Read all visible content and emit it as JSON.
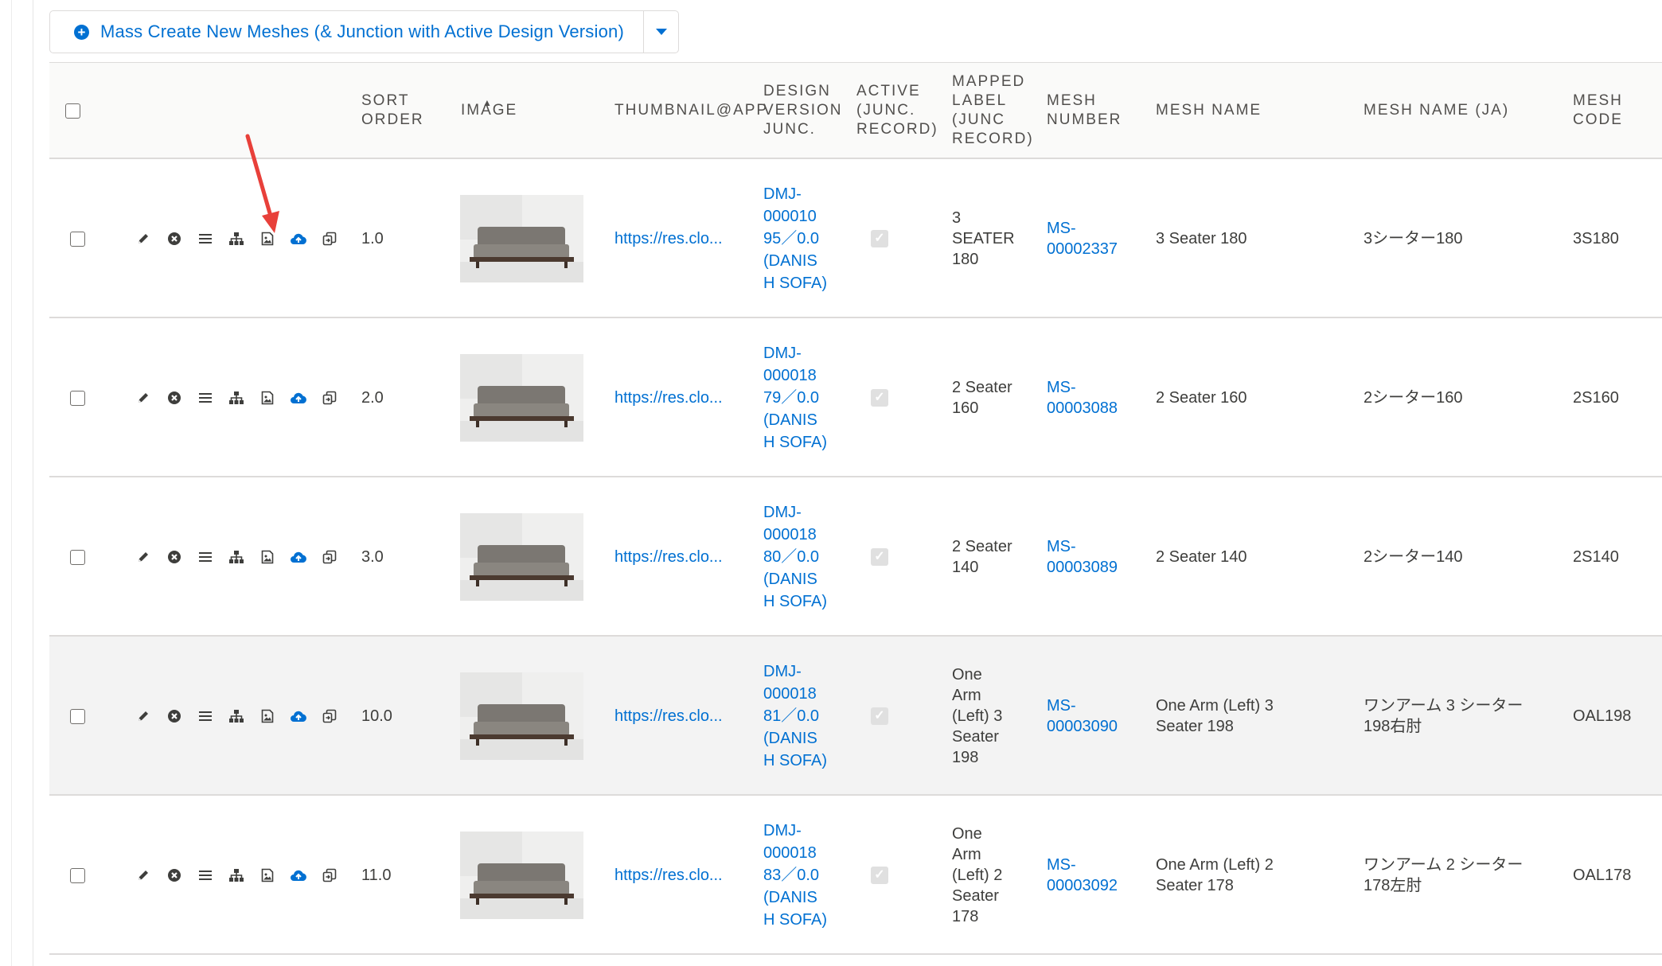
{
  "toolbar": {
    "mass_create_label": "Mass Create New Meshes (& Junction with Active Design Version)"
  },
  "columns": {
    "sort_order": [
      "SORT",
      "ORDER"
    ],
    "image": "IMAGE",
    "thumbnail": "THUMBNAIL@APP",
    "design_version": [
      "DESIGN",
      "VERSION",
      "JUNC."
    ],
    "active": [
      "ACTIVE",
      "(JUNC.",
      "RECORD)"
    ],
    "mapped_label": [
      "MAPPED",
      "LABEL",
      "(JUNC",
      "RECORD)"
    ],
    "mesh_number": [
      "MESH",
      "NUMBER"
    ],
    "mesh_name": "MESH NAME",
    "mesh_name_ja": "MESH NAME (JA)",
    "mesh_code": [
      "MESH",
      "CODE"
    ]
  },
  "row_actions": [
    "pencil-icon",
    "remove-icon",
    "list-icon",
    "hierarchy-icon",
    "image-icon",
    "upload-cloud-icon",
    "copy-icon"
  ],
  "rows": [
    {
      "sort_order": "1.0",
      "thumbnail": "https://res.clo...",
      "design_version": [
        "DMJ-",
        "000010",
        "95／0.0",
        "(DANIS",
        "H SOFA)"
      ],
      "mapped_label": [
        "3",
        "SEATER",
        "180"
      ],
      "mesh_number": [
        "MS-",
        "00002337"
      ],
      "mesh_name": [
        "3 Seater 180"
      ],
      "mesh_name_ja": [
        "3シーター180"
      ],
      "mesh_code": "3S180",
      "highlight": false
    },
    {
      "sort_order": "2.0",
      "thumbnail": "https://res.clo...",
      "design_version": [
        "DMJ-",
        "000018",
        "79／0.0",
        "(DANIS",
        "H SOFA)"
      ],
      "mapped_label": [
        "2 Seater",
        "160"
      ],
      "mesh_number": [
        "MS-",
        "00003088"
      ],
      "mesh_name": [
        "2 Seater 160"
      ],
      "mesh_name_ja": [
        "2シーター160"
      ],
      "mesh_code": "2S160",
      "highlight": false
    },
    {
      "sort_order": "3.0",
      "thumbnail": "https://res.clo...",
      "design_version": [
        "DMJ-",
        "000018",
        "80／0.0",
        "(DANIS",
        "H SOFA)"
      ],
      "mapped_label": [
        "2 Seater",
        "140"
      ],
      "mesh_number": [
        "MS-",
        "00003089"
      ],
      "mesh_name": [
        "2 Seater 140"
      ],
      "mesh_name_ja": [
        "2シーター140"
      ],
      "mesh_code": "2S140",
      "highlight": false
    },
    {
      "sort_order": "10.0",
      "thumbnail": "https://res.clo...",
      "design_version": [
        "DMJ-",
        "000018",
        "81／0.0",
        "(DANIS",
        "H SOFA)"
      ],
      "mapped_label": [
        "One",
        "Arm",
        "(Left) 3",
        "Seater",
        "198"
      ],
      "mesh_number": [
        "MS-",
        "00003090"
      ],
      "mesh_name": [
        "One Arm (Left) 3",
        "Seater 198"
      ],
      "mesh_name_ja": [
        "ワンアーム 3 シーター",
        "198右肘"
      ],
      "mesh_code": "OAL198",
      "highlight": true
    },
    {
      "sort_order": "11.0",
      "thumbnail": "https://res.clo...",
      "design_version": [
        "DMJ-",
        "000018",
        "83／0.0",
        "(DANIS",
        "H SOFA)"
      ],
      "mapped_label": [
        "One",
        "Arm",
        "(Left) 2",
        "Seater",
        "178"
      ],
      "mesh_number": [
        "MS-",
        "00003092"
      ],
      "mesh_name": [
        "One Arm (Left) 2",
        "Seater 178"
      ],
      "mesh_name_ja": [
        "ワンアーム 2 シーター",
        "178左肘"
      ],
      "mesh_code": "OAL178",
      "highlight": false
    }
  ],
  "colors": {
    "link": "#0070d2",
    "arrow": "#e8403a",
    "header_bg": "#fafaf9",
    "highlight_row": "#f3f3f3"
  }
}
